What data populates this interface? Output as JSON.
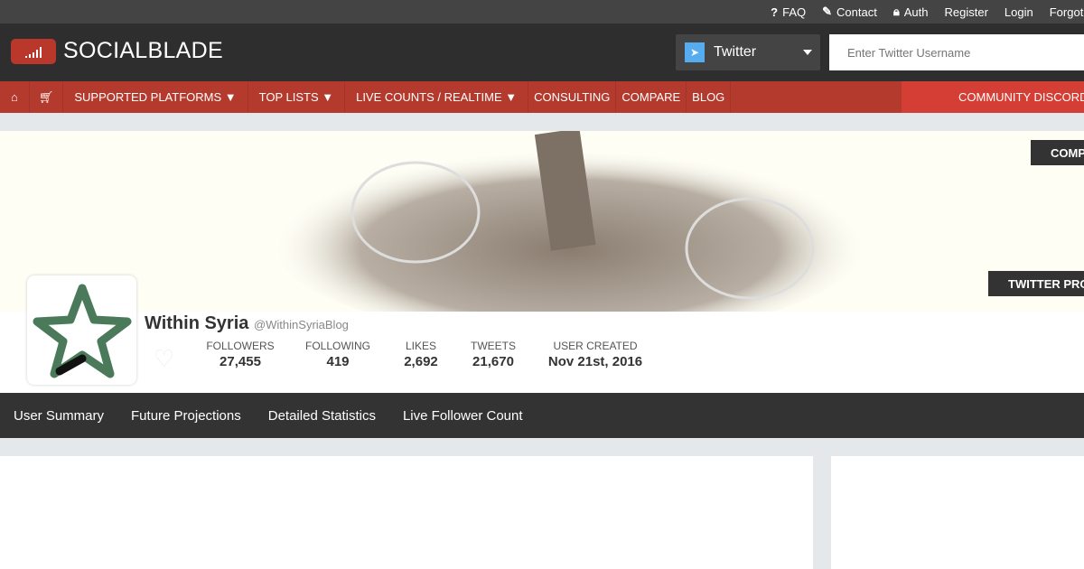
{
  "topbar": {
    "faq": "FAQ",
    "contact": "Contact",
    "auth": "Auth",
    "register": "Register",
    "login": "Login",
    "forgot": "Forgot Password"
  },
  "header": {
    "logo": "SOCIALBLADE",
    "platform": "Twitter",
    "search_placeholder": "Enter Twitter Username"
  },
  "nav": {
    "platforms": "SUPPORTED PLATFORMS ▼",
    "toplists": "TOP LISTS ▼",
    "livecounts": "LIVE COUNTS / REALTIME ▼",
    "consulting": "CONSULTING",
    "compare": "COMPARE",
    "blog": "BLOG",
    "discord": "COMMUNITY DISCORD"
  },
  "banner": {
    "compare_button": "COMPARE",
    "profile_button": "TWITTER PROFILE"
  },
  "profile": {
    "name": "Within Syria",
    "handle": "@WithinSyriaBlog",
    "stats": [
      {
        "label": "FOLLOWERS",
        "value": "27,455"
      },
      {
        "label": "FOLLOWING",
        "value": "419"
      },
      {
        "label": "LIKES",
        "value": "2,692"
      },
      {
        "label": "TWEETS",
        "value": "21,670"
      },
      {
        "label": "USER CREATED",
        "value": "Nov 21st, 2016"
      }
    ]
  },
  "tabs": [
    "User Summary",
    "Future Projections",
    "Detailed Statistics",
    "Live Follower Count"
  ]
}
